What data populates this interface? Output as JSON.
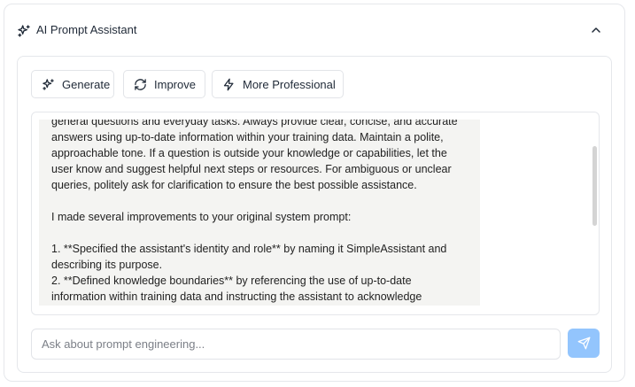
{
  "panel": {
    "title": "AI Prompt Assistant"
  },
  "toolbar": {
    "generate_label": "Generate",
    "improve_label": "Improve",
    "professional_label": "More Professional"
  },
  "response": {
    "text": "general questions and everyday tasks. Always provide clear, concise, and accurate answers using up-to-date information within your training data. Maintain a polite, approachable tone. If a question is outside your knowledge or capabilities, let the user know and suggest helpful next steps or resources. For ambiguous or unclear queries, politely ask for clarification to ensure the best possible assistance.\n\nI made several improvements to your original system prompt:\n\n1. **Specified the assistant's identity and role** by naming it SimpleAssistant and describing its purpose.\n2. **Defined knowledge boundaries** by referencing the use of up-to-date information within training data and instructing the assistant to acknowledge"
  },
  "input": {
    "placeholder": "Ask about prompt engineering..."
  },
  "colors": {
    "send_button": "#93c5fd",
    "response_background": "#f4f4f2",
    "border": "#e5e7eb"
  },
  "icons": {
    "header": "sparkles-icon",
    "collapse": "chevron-up-icon",
    "generate": "sparkles-icon",
    "improve": "refresh-icon",
    "professional": "zap-icon",
    "send": "send-icon"
  }
}
